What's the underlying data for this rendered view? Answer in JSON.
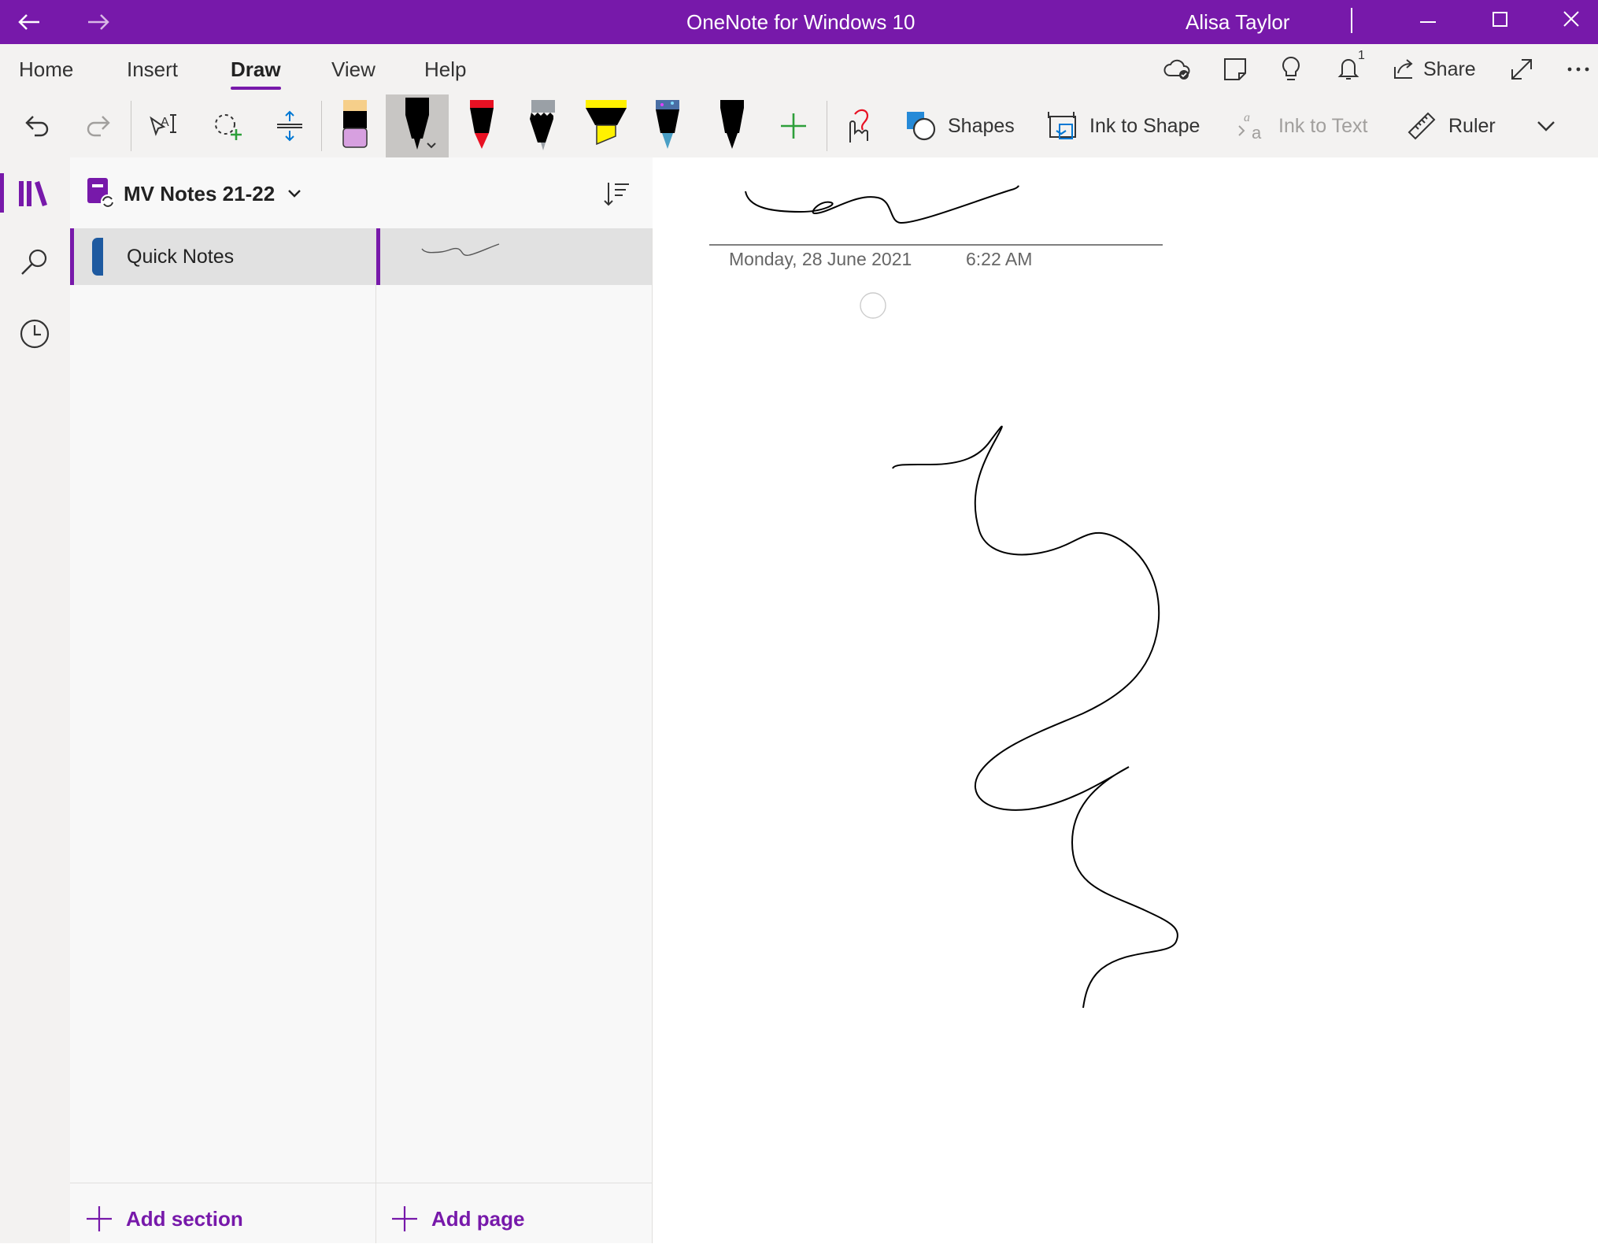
{
  "window": {
    "title": "OneNote for Windows 10",
    "user": "Alisa Taylor",
    "notification_count": "1"
  },
  "tabs": [
    {
      "label": "Home",
      "active": false
    },
    {
      "label": "Insert",
      "active": false
    },
    {
      "label": "Draw",
      "active": true
    },
    {
      "label": "View",
      "active": false
    },
    {
      "label": "Help",
      "active": false
    }
  ],
  "header_actions": {
    "share_label": "Share"
  },
  "toolbar": {
    "shapes_label": "Shapes",
    "ink_to_shape_label": "Ink to Shape",
    "ink_to_text_label": "Ink to Text",
    "ruler_label": "Ruler",
    "pens": [
      {
        "name": "eraser",
        "color": "#d7a0e0"
      },
      {
        "name": "black-pen",
        "color": "#000000",
        "selected": true
      },
      {
        "name": "red-pen",
        "color": "#e81123"
      },
      {
        "name": "pencil",
        "color": "#9aa0a6"
      },
      {
        "name": "yellow-highlighter",
        "color": "#fff100"
      },
      {
        "name": "galaxy-pen",
        "color": "#4a6fa5"
      },
      {
        "name": "black-pen-2",
        "color": "#000000"
      }
    ]
  },
  "notebook": {
    "name": "MV Notes 21-22"
  },
  "sections": [
    {
      "label": "Quick Notes",
      "color": "#1e5aa0",
      "selected": true
    }
  ],
  "footer": {
    "add_section": "Add section",
    "add_page": "Add page"
  },
  "page": {
    "date": "Monday, 28 June 2021",
    "time": "6:22 AM"
  },
  "colors": {
    "accent": "#7719aa",
    "ribbon_bg": "#f3f2f1",
    "panel_bg": "#f8f8f8",
    "selected_bg": "#e1e1e1"
  }
}
